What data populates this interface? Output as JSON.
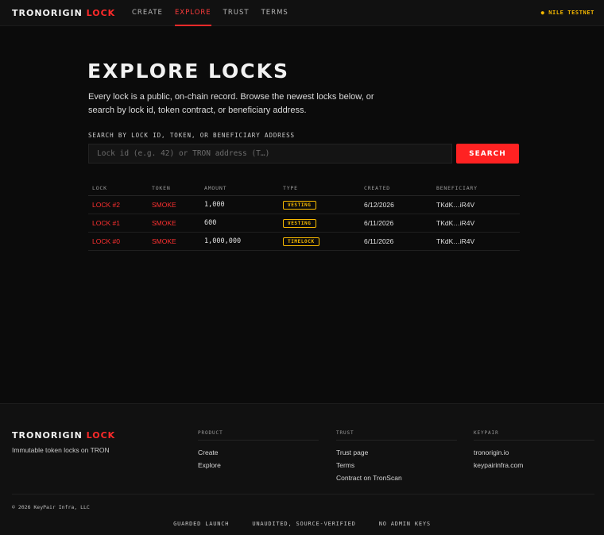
{
  "header": {
    "brand_main": "TRONORIGIN",
    "brand_accent": "LOCK",
    "nav": [
      "CREATE",
      "EXPLORE",
      "TRUST",
      "TERMS"
    ],
    "active_nav": "EXPLORE",
    "network": "● NILE TESTNET"
  },
  "main": {
    "title": "EXPLORE LOCKS",
    "intro": "Every lock is a public, on-chain record. Browse the newest locks below, or search by lock id, token contract, or beneficiary address.",
    "search_label": "SEARCH BY LOCK ID, TOKEN, OR BENEFICIARY ADDRESS",
    "search_placeholder": "Lock id (e.g. 42) or TRON address (T…)",
    "search_button": "SEARCH"
  },
  "table": {
    "columns": [
      "LOCK",
      "TOKEN",
      "AMOUNT",
      "TYPE",
      "CREATED",
      "BENEFICIARY"
    ],
    "rows": [
      {
        "lock": "LOCK #2",
        "token": "SMOKE",
        "amount": "1,000",
        "type": "VESTING",
        "created": "6/12/2026",
        "beneficiary": "TKdK…iR4V"
      },
      {
        "lock": "LOCK #1",
        "token": "SMOKE",
        "amount": "600",
        "type": "VESTING",
        "created": "6/11/2026",
        "beneficiary": "TKdK…iR4V"
      },
      {
        "lock": "LOCK #0",
        "token": "SMOKE",
        "amount": "1,000,000",
        "type": "TIMELOCK",
        "created": "6/11/2026",
        "beneficiary": "TKdK…iR4V"
      }
    ]
  },
  "footer": {
    "brand_main": "TRONORIGIN",
    "brand_accent": "LOCK",
    "tagline": "Immutable token locks on TRON",
    "product": {
      "heading": "PRODUCT",
      "links": [
        "Create",
        "Explore"
      ]
    },
    "trust": {
      "heading": "TRUST",
      "links": [
        "Trust page",
        "Terms",
        "Contract on TronScan"
      ]
    },
    "keypair": {
      "heading": "KEYPAIR",
      "links": [
        "tronorigin.io",
        "keypairinfra.com"
      ]
    },
    "copyright": "© 2026 KeyPair Infra, LLC",
    "badges": [
      "GUARDED LAUNCH",
      "UNAUDITED, SOURCE-VERIFIED",
      "NO ADMIN KEYS"
    ]
  },
  "colors": {
    "accent": "#ff2a2a",
    "warning": "#f5b800",
    "background": "#0b0b0b"
  }
}
